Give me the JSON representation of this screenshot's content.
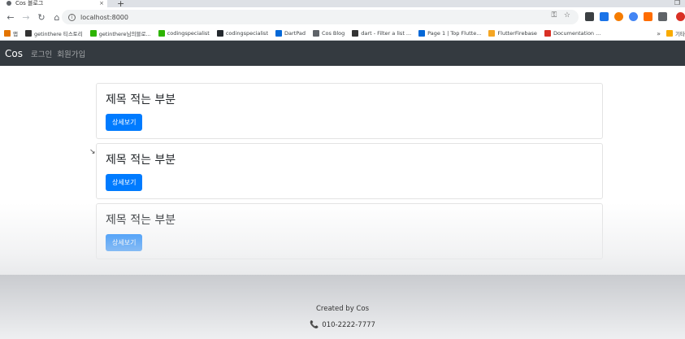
{
  "browser": {
    "tab_title": "Cos 블로그",
    "tab_close": "×",
    "new_tab": "+",
    "url": "localhost:8000",
    "window_control": "❐",
    "bookmarks": [
      {
        "label": "앱",
        "color": "#e37400"
      },
      {
        "label": "getinthere 티스토리",
        "color": "#333333"
      },
      {
        "label": "getinthere님의블로...",
        "color": "#2db400"
      },
      {
        "label": "codingspecialist",
        "color": "#2db400"
      },
      {
        "label": "codingspecialist",
        "color": "#24292e"
      },
      {
        "label": "DartPad",
        "color": "#0468d7"
      },
      {
        "label": "Cos Blog",
        "color": "#5f6368"
      },
      {
        "label": "dart - Filter a list ...",
        "color": "#333333"
      },
      {
        "label": "Page 1 | Top Flutte...",
        "color": "#0468d7"
      },
      {
        "label": "FlutterFirebase",
        "color": "#f5a623"
      },
      {
        "label": "Documentation ...",
        "color": "#d93025"
      }
    ],
    "bookmarks_more": "»",
    "bookmarks_other": "기타"
  },
  "navbar": {
    "brand": "Cos",
    "links": [
      "로그인",
      "회원가입"
    ]
  },
  "posts": [
    {
      "title": "제목 적는 부분",
      "button": "상세보기"
    },
    {
      "title": "제목 적는 부분",
      "button": "상세보기"
    },
    {
      "title": "제목 적는 부분",
      "button": "상세보기"
    }
  ],
  "footer": {
    "credit": "Created by Cos",
    "phone_icon": "📞",
    "phone": "010-2222-7777"
  },
  "colors": {
    "navbar_bg": "#343a40",
    "button_primary": "#007bff"
  }
}
